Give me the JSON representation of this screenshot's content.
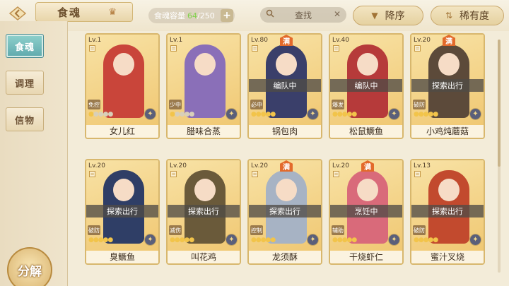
{
  "header": {
    "back_icon": "diamond-back-arrow-icon",
    "title": "食魂",
    "capacity_label": "食魂容量",
    "capacity_current": "64",
    "capacity_total": "/250",
    "add_label": "+",
    "search_placeholder": "查找",
    "search_clear": "✕",
    "sort_label": "降序",
    "rarity_label": "稀有度"
  },
  "sidebar": {
    "tabs": [
      {
        "label": "食魂",
        "active": true
      },
      {
        "label": "调理",
        "active": false
      },
      {
        "label": "信物",
        "active": false
      }
    ],
    "decompose_label": "分解"
  },
  "cards": [
    {
      "level": "Lv.1",
      "name": "女儿红",
      "status": "",
      "role": "免控",
      "full": false,
      "stars_on": 1,
      "palette": "#c9453a"
    },
    {
      "level": "Lv.1",
      "name": "腊味合蒸",
      "status": "",
      "role": "少中",
      "full": false,
      "stars_on": 1,
      "palette": "#8a6fb8"
    },
    {
      "level": "Lv.80",
      "name": "锅包肉",
      "status": "编队中",
      "role": "必中",
      "full": true,
      "stars_on": 5,
      "palette": "#3a3f6a"
    },
    {
      "level": "Lv.40",
      "name": "松鼠鳜鱼",
      "status": "编队中",
      "role": "爆发",
      "full": false,
      "stars_on": 5,
      "palette": "#b63a3a"
    },
    {
      "level": "Lv.20",
      "name": "小鸡炖蘑菇",
      "status": "探索出行",
      "role": "破防",
      "full": true,
      "stars_on": 5,
      "palette": "#5c4a3a"
    },
    {
      "level": "Lv.20",
      "name": "臭鳜鱼",
      "status": "探索出行",
      "role": "破防",
      "full": false,
      "stars_on": 5,
      "palette": "#2f3e66"
    },
    {
      "level": "Lv.20",
      "name": "叫花鸡",
      "status": "探索出行",
      "role": "减伤",
      "full": false,
      "stars_on": 5,
      "palette": "#6a5a3a"
    },
    {
      "level": "Lv.20",
      "name": "龙须酥",
      "status": "探索出行",
      "role": "控制",
      "full": true,
      "stars_on": 5,
      "palette": "#a7b3c4"
    },
    {
      "level": "Lv.20",
      "name": "干烧虾仁",
      "status": "烹饪中",
      "role": "辅助",
      "full": true,
      "stars_on": 5,
      "palette": "#d96a7a"
    },
    {
      "level": "Lv.13",
      "name": "蜜汁叉烧",
      "status": "探索出行",
      "role": "破防",
      "full": false,
      "stars_on": 5,
      "palette": "#c24a2e"
    }
  ]
}
